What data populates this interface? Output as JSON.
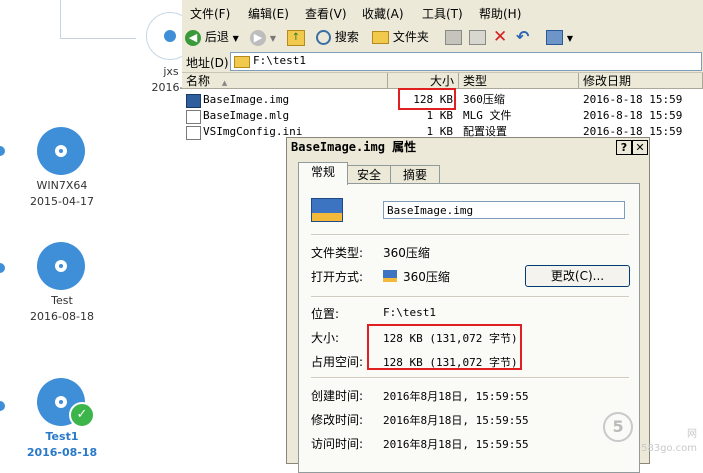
{
  "launcher": {
    "partial_label": "jxs",
    "partial_date": "2016-0",
    "items": [
      {
        "name": "WIN7X64",
        "date": "2015-04-17"
      },
      {
        "name": "Test",
        "date": "2016-08-18"
      },
      {
        "name": "Test1",
        "date": "2016-08-18"
      }
    ]
  },
  "explorer": {
    "menu": [
      "文件(F)",
      "编辑(E)",
      "查看(V)",
      "收藏(A)",
      "工具(T)",
      "帮助(H)"
    ],
    "toolbar": {
      "back": "后退",
      "search": "搜索",
      "folders": "文件夹"
    },
    "address_label": "地址(D)",
    "address_value": "F:\\test1",
    "columns": {
      "name": "名称",
      "size": "大小",
      "type": "类型",
      "modified": "修改日期"
    },
    "files": [
      {
        "name": "BaseImage.img",
        "size": "128 KB",
        "type": "360压缩",
        "modified": "2016-8-18 15:59"
      },
      {
        "name": "BaseImage.mlg",
        "size": "1 KB",
        "type": "MLG 文件",
        "modified": "2016-8-18 15:59"
      },
      {
        "name": "VSImgConfig.ini",
        "size": "1 KB",
        "type": "配置设置",
        "modified": "2016-8-18 15:59"
      }
    ]
  },
  "dialog": {
    "title": "BaseImage.img 属性",
    "tabs": [
      "常规",
      "安全",
      "摘要"
    ],
    "filename": "BaseImage.img",
    "file_type_label": "文件类型:",
    "file_type_value": "360压缩",
    "open_with_label": "打开方式:",
    "open_with_value": "360压缩",
    "change_button": "更改(C)...",
    "location_label": "位置:",
    "location_value": "F:\\test1",
    "size_label": "大小:",
    "size_value": "128 KB (131,072 字节)",
    "disk_size_label": "占用空间:",
    "disk_size_value": "128 KB (131,072 字节)",
    "created_label": "创建时间:",
    "created_value": "2016年8月18日, 15:59:55",
    "modified_label": "修改时间:",
    "modified_value": "2016年8月18日, 15:59:55",
    "accessed_label": "访问时间:",
    "accessed_value": "2016年8月18日, 15:59:55"
  },
  "watermark": {
    "brand": "网",
    "site": "583go.com"
  },
  "colors": {
    "accent_blue": "#3e8fd8",
    "highlight_red": "#e02020",
    "check_green": "#3cb54a"
  }
}
